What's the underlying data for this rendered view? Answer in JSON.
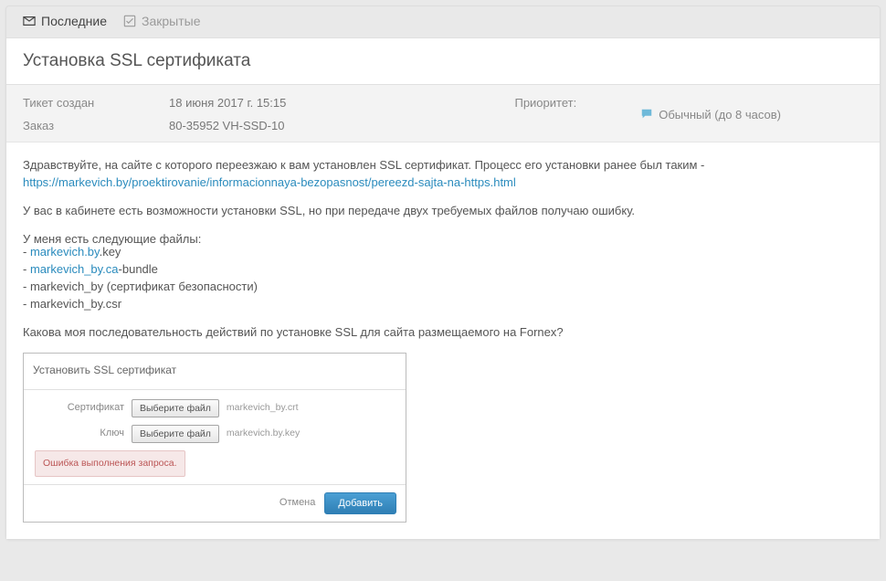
{
  "tabs": {
    "recent": "Последние",
    "closed": "Закрытые"
  },
  "ticket": {
    "title": "Установка SSL сертификата",
    "created_label": "Тикет создан",
    "created_value": "18 июня 2017 г. 15:15",
    "order_label": "Заказ",
    "order_value": "80-35952 VH-SSD-10",
    "priority_label": "Приоритет:",
    "priority_value": "Обычный (до 8 часов)"
  },
  "message": {
    "intro": "Здравствуйте, на сайте с которого переезжаю к вам установлен SSL сертификат. Процесс его установки ранее был таким -",
    "link": "https://markevich.by/proektirovanie/informacionnaya-bezopasnost/pereezd-sajta-na-https.html",
    "line2": "У вас в кабинете есть возможности установки SSL, но при передаче двух требуемых файлов получаю ошибку.",
    "files_intro": "У меня есть следующие файлы:",
    "files": {
      "f1_prefix": "- ",
      "f1_link": "markevich.by",
      "f1_suffix": ".key",
      "f2_prefix": "- ",
      "f2_link": "markevich_by.ca",
      "f2_suffix": "-bundle",
      "f3": "- markevich_by (сертификат безопасности)",
      "f4": "- markevich_by.csr"
    },
    "question": "Какова моя последовательность действий по установке SSL для сайта размещаемого на Fornex?"
  },
  "ssl_dialog": {
    "title": "Установить SSL сертификат",
    "cert_label": "Сертификат",
    "key_label": "Ключ",
    "choose_file": "Выберите файл",
    "cert_filename": "markevich_by.crt",
    "key_filename": "markevich.by.key",
    "error": "Ошибка выполнения запроса.",
    "cancel": "Отмена",
    "add": "Добавить"
  }
}
